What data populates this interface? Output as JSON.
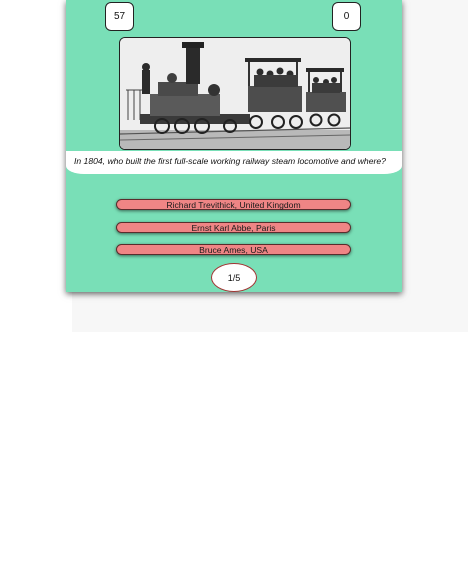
{
  "header": {
    "timer_value": "57",
    "score_value": "0"
  },
  "question": {
    "image_subject": "steam-locomotive-photo",
    "text": "In 1804, who built the first full-scale working railway steam locomotive and where?"
  },
  "answers": [
    {
      "label": "Richard Trevithick, United Kingdom"
    },
    {
      "label": "Ernst Karl Abbe, Paris"
    },
    {
      "label": "Bruce Ames, USA"
    }
  ],
  "progress": {
    "label": "1/5"
  },
  "colors": {
    "card_background": "#79dfb7",
    "answer_button": "#ef8585",
    "question_band": "#ffffff"
  }
}
